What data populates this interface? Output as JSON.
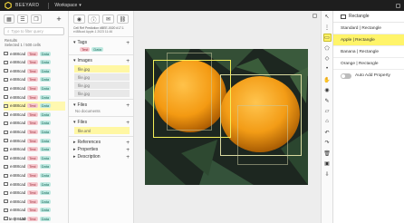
{
  "topbar": {
    "brand": "BEEYARD",
    "workspace": "Workspace"
  },
  "left": {
    "search_placeholder": "Type to filter query",
    "results_label": "Results",
    "selected_label": "Selected 1 / 500 cells",
    "rows": [
      {
        "name": "e488cad",
        "tag1": "Test",
        "tag2": "Data"
      },
      {
        "name": "e488cad",
        "tag1": "Test",
        "tag2": "Data"
      },
      {
        "name": "e488cad",
        "tag1": "Test",
        "tag2": "Data"
      },
      {
        "name": "e488cad",
        "tag1": "Test",
        "tag2": "Data"
      },
      {
        "name": "e488cad",
        "tag1": "Test",
        "tag2": "Data"
      },
      {
        "name": "e488cad",
        "tag1": "Test",
        "tag2": "Data"
      },
      {
        "name": "e488cad",
        "tag1": "Test",
        "tag2": "Data"
      },
      {
        "name": "e488cad",
        "tag1": "Test",
        "tag2": "Data"
      },
      {
        "name": "e488cad",
        "tag1": "Test",
        "tag2": "Data"
      },
      {
        "name": "e488cad",
        "tag1": "Test",
        "tag2": "Data"
      },
      {
        "name": "e488cad",
        "tag1": "Test",
        "tag2": "Data"
      },
      {
        "name": "e488cad",
        "tag1": "Test",
        "tag2": "Data"
      },
      {
        "name": "e488cad",
        "tag1": "Test",
        "tag2": "Data"
      },
      {
        "name": "e488cad",
        "tag1": "Test",
        "tag2": "Data"
      },
      {
        "name": "e488cad",
        "tag1": "Test",
        "tag2": "Data"
      },
      {
        "name": "e488cad",
        "tag1": "Test",
        "tag2": "Data"
      },
      {
        "name": "e488cad",
        "tag1": "Test",
        "tag2": "Data"
      },
      {
        "name": "e488cad",
        "tag1": "Test",
        "tag2": "Data"
      },
      {
        "name": "e488cad",
        "tag1": "Test",
        "tag2": "Data"
      },
      {
        "name": "e488cad",
        "tag1": "Test",
        "tag2": "Data"
      }
    ],
    "selected_row": 6,
    "pager": {
      "page": "1",
      "total": "120"
    }
  },
  "mid": {
    "meta_line1": "Cell Ref      Prediction  #BEE-0020  #17.1",
    "meta_line2": "e488cad  Apple-1 2023 11:46",
    "sections": {
      "tags": "Tags",
      "images": "Images",
      "files_left": "Files",
      "files": "Files",
      "references": "References",
      "properties": "Properties",
      "description": "Description"
    },
    "tags": [
      "Test",
      "Data"
    ],
    "images": [
      "file.jpg",
      "file.jpg",
      "file.jpg",
      "file.jpg"
    ],
    "no_results": "No documents",
    "file_xml": "file.xml"
  },
  "right": {
    "header": "Rectangle",
    "options": [
      "Standard | Rectangle",
      "Apple | Rectangle",
      "Banana | Rectangle",
      "Orange | Rectangle"
    ],
    "active_index": 1,
    "toggle_label": "Auto Add Property"
  },
  "icons": {
    "logo": "hexagon-logo-icon",
    "search": "search-icon",
    "strip": [
      "cursor-icon",
      "dots-icon",
      "rectangle-icon",
      "polygon-icon",
      "tag-icon",
      "point-icon",
      "hand-icon",
      "eye-icon",
      "brush-icon",
      "eraser-icon",
      "home-icon",
      "undo-icon",
      "redo-icon",
      "trash-icon",
      "save-icon",
      "download-icon"
    ]
  },
  "colors": {
    "highlight": "#fff46a",
    "tag_test": "#f6c9cf",
    "tag_data": "#bfe9e1",
    "topbar": "#1e1e1e"
  }
}
